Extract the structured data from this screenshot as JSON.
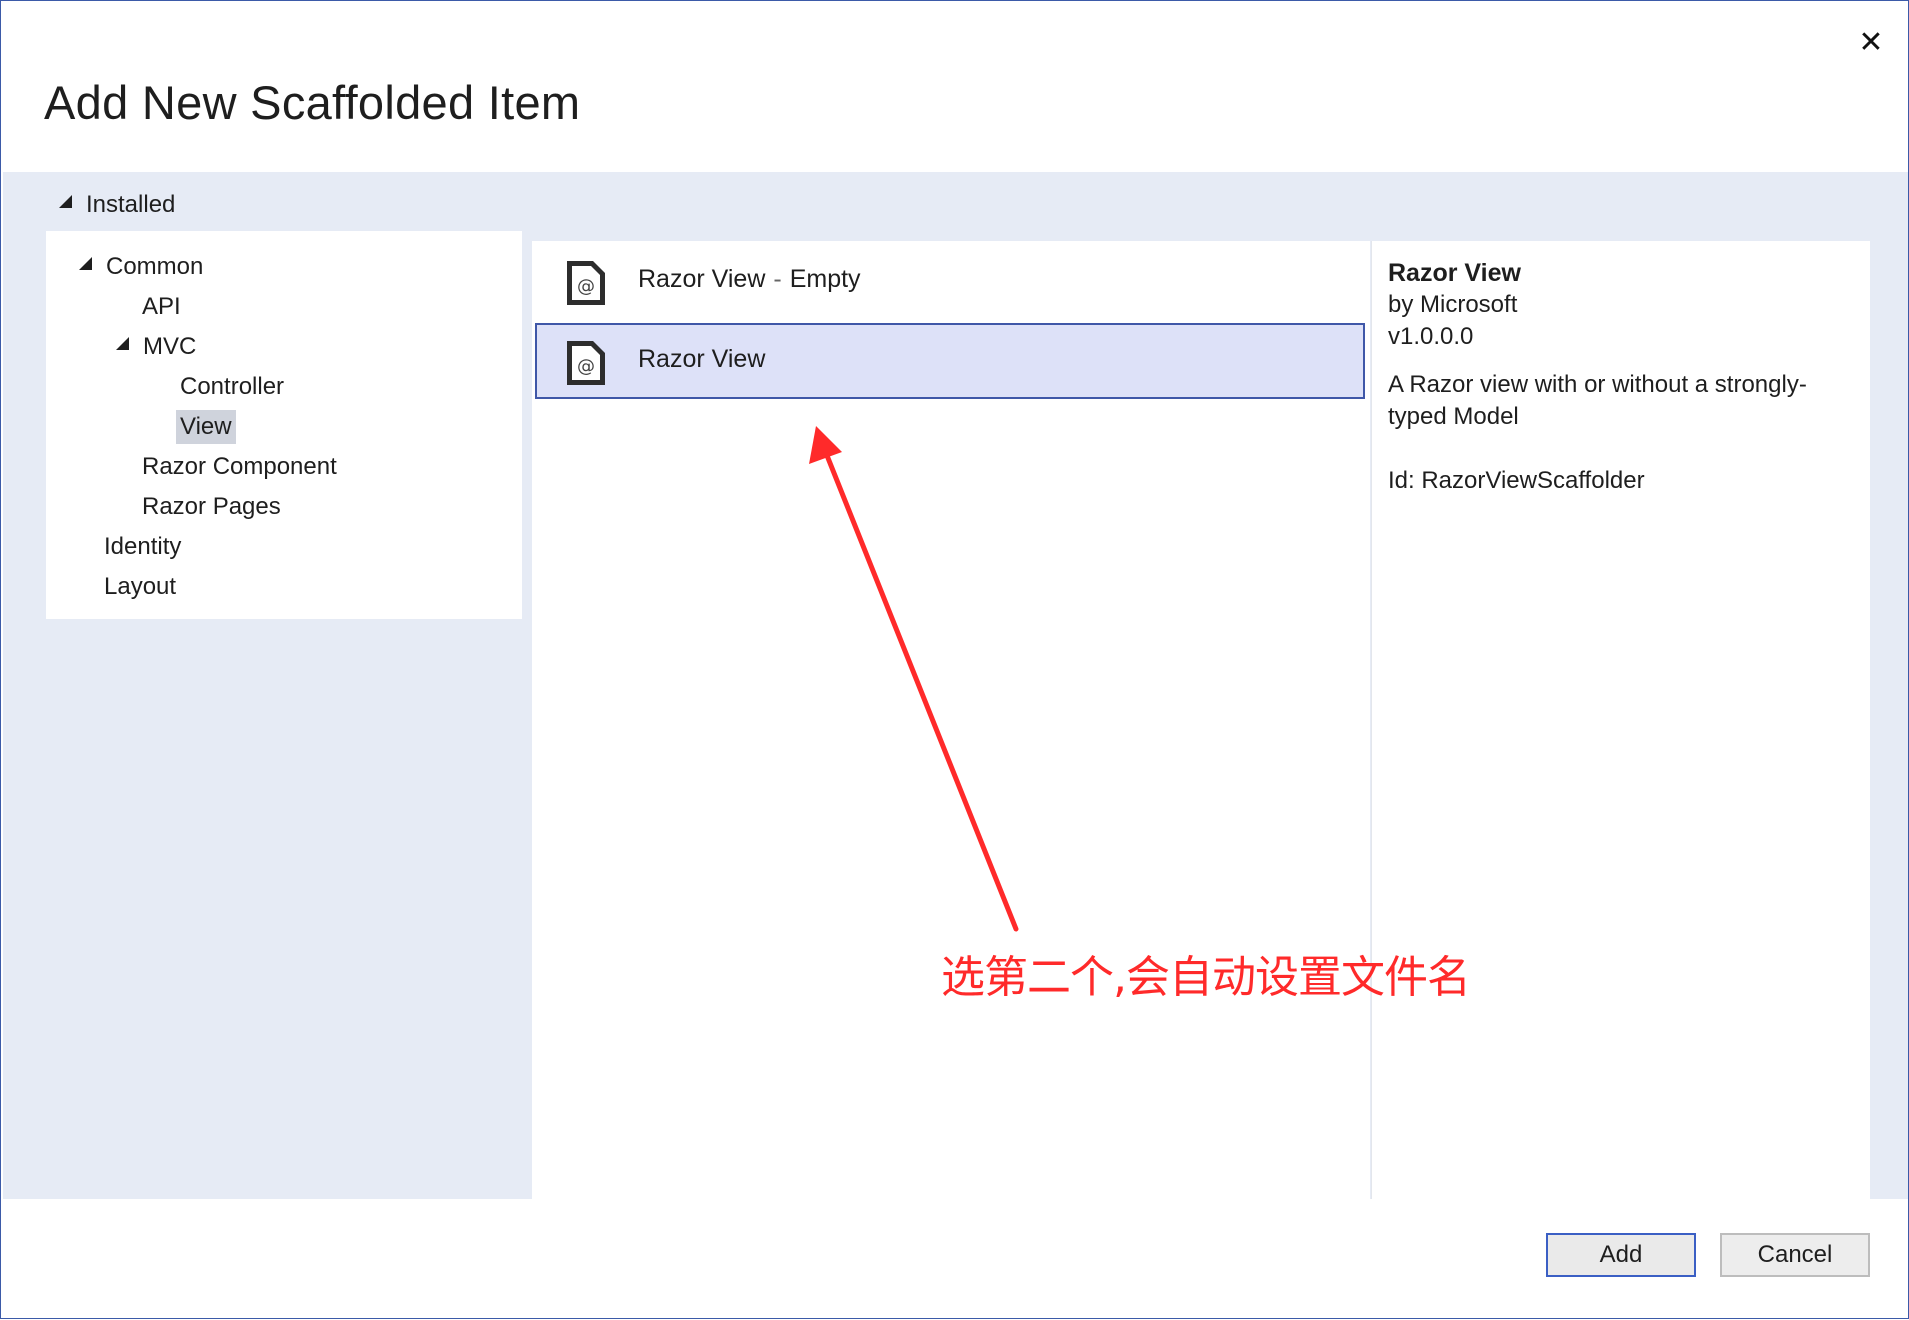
{
  "dialog": {
    "title": "Add New Scaffolded Item",
    "close_icon": "close-icon"
  },
  "tree": {
    "root_label": "Installed",
    "items": [
      {
        "label": "Common",
        "expanded": true
      },
      {
        "label": "API"
      },
      {
        "label": "MVC",
        "expanded": true
      },
      {
        "label": "Controller"
      },
      {
        "label": "View",
        "selected": true
      },
      {
        "label": "Razor Component"
      },
      {
        "label": "Razor Pages"
      },
      {
        "label": "Identity"
      },
      {
        "label": "Layout"
      }
    ]
  },
  "list": {
    "items": [
      {
        "name": "Razor View",
        "suffix": "Empty",
        "icon": "razor-file-icon"
      },
      {
        "name": "Razor View",
        "icon": "razor-file-icon",
        "selected": true
      }
    ]
  },
  "details": {
    "title": "Razor View",
    "author": "by Microsoft",
    "version": "v1.0.0.0",
    "description": "A Razor view with or without a strongly-typed Model",
    "id": "Id: RazorViewScaffolder"
  },
  "buttons": {
    "add": "Add",
    "cancel": "Cancel"
  },
  "annotation": {
    "text": "选第二个,会自动设置文件名",
    "color": "#ff2a2a"
  },
  "colors": {
    "accent": "#3b5fc4",
    "body_bg": "#e6ebf5",
    "selection_bg": "#dde1f8"
  }
}
